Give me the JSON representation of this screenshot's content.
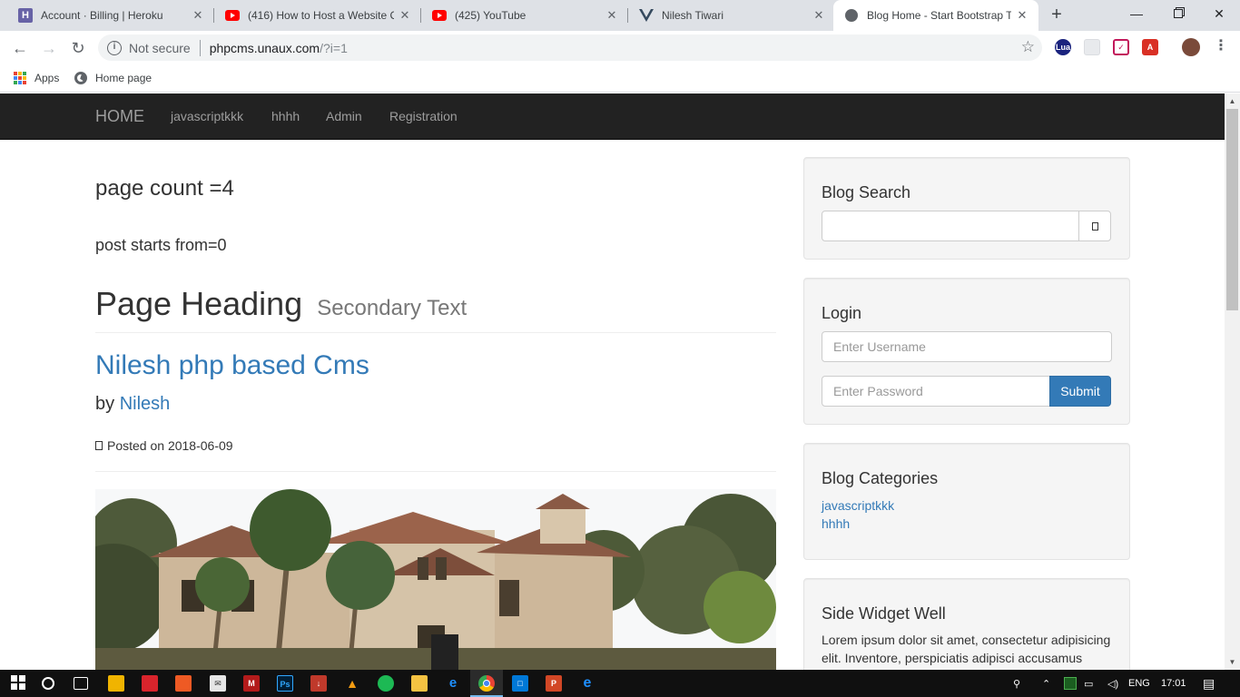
{
  "browser": {
    "tabs": [
      {
        "title": "Account · Billing | Heroku",
        "favicon": "heroku-icon",
        "active": false
      },
      {
        "title": "(416) How to Host a Website C",
        "favicon": "youtube-icon",
        "active": false
      },
      {
        "title": "(425) YouTube",
        "favicon": "youtube-icon",
        "active": false
      },
      {
        "title": "Nilesh Tiwari",
        "favicon": "vue-icon",
        "active": false
      },
      {
        "title": "Blog Home - Start Bootstrap Te",
        "favicon": "globe-icon",
        "active": true
      }
    ],
    "security_label": "Not secure",
    "url_host": "phpcms.unaux.com",
    "url_path": "/?i=1",
    "bookmarks": [
      {
        "label": "Apps"
      },
      {
        "label": "Home page"
      }
    ]
  },
  "site": {
    "brand": "HOME",
    "nav": [
      "javascriptkkk",
      "hhhh",
      "Admin",
      "Registration"
    ]
  },
  "main": {
    "page_count": "page count =4",
    "post_start": "post starts from=0",
    "heading": "Page Heading",
    "heading_secondary": "Secondary Text",
    "post": {
      "title": "Nilesh php based Cms",
      "by_label": "by",
      "author": "Nilesh",
      "posted": "Posted on 2018-06-09"
    }
  },
  "sidebar": {
    "search": {
      "title": "Blog Search",
      "placeholder": ""
    },
    "login": {
      "title": "Login",
      "username_placeholder": "Enter Username",
      "password_placeholder": "Enter Password",
      "submit_label": "Submit"
    },
    "categories": {
      "title": "Blog Categories",
      "items": [
        "javascriptkkk",
        "hhhh"
      ]
    },
    "widget": {
      "title": "Side Widget Well",
      "text": "Lorem ipsum dolor sit amet, consectetur adipisicing elit. Inventore, perspiciatis adipisci accusamus"
    }
  },
  "taskbar": {
    "language": "ENG",
    "time": "17:01"
  },
  "colors": {
    "navbar_bg": "#222222",
    "link": "#337ab7",
    "submit_bg": "#337ab7",
    "well_bg": "#f5f5f5"
  }
}
